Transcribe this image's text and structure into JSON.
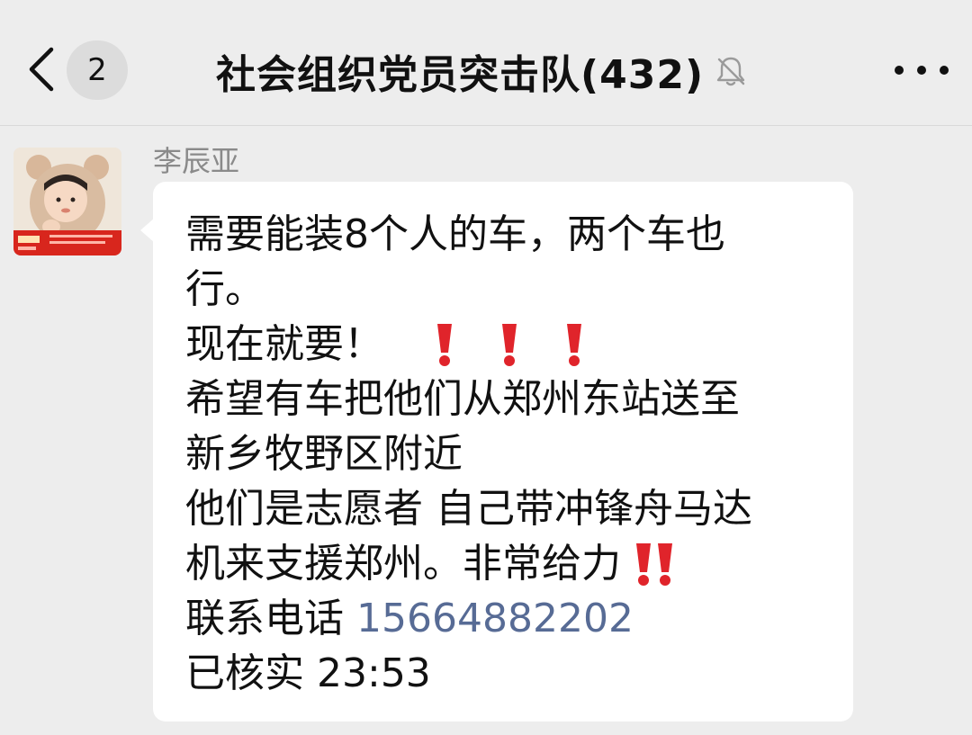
{
  "navbar": {
    "unread_count": "2",
    "title": "社会组织党员突击队(432)",
    "icons": [
      "back-chevron-icon",
      "mute-bell-icon",
      "more-dots-icon"
    ]
  },
  "message": {
    "sender": "李辰亚",
    "lines": [
      "需要能装8个人的车，两个车也",
      "行。",
      "现在就要！",
      "希望有车把他们从郑州东站送至",
      "新乡牧野区附近",
      "他们是志愿者 自己带冲锋舟马达",
      "机来支援郑州。非常给力",
      "联系电话",
      "已核实"
    ],
    "phone": "15664882202",
    "verified_time": "23:53",
    "emoji": [
      "heavy-exclamation-icon",
      "double-exclamation-icon"
    ]
  },
  "colors": {
    "background": "#ededed",
    "bubble": "#ffffff",
    "link": "#576b95",
    "emoji_red": "#e0242b",
    "sender_name": "#8a8a8a"
  }
}
